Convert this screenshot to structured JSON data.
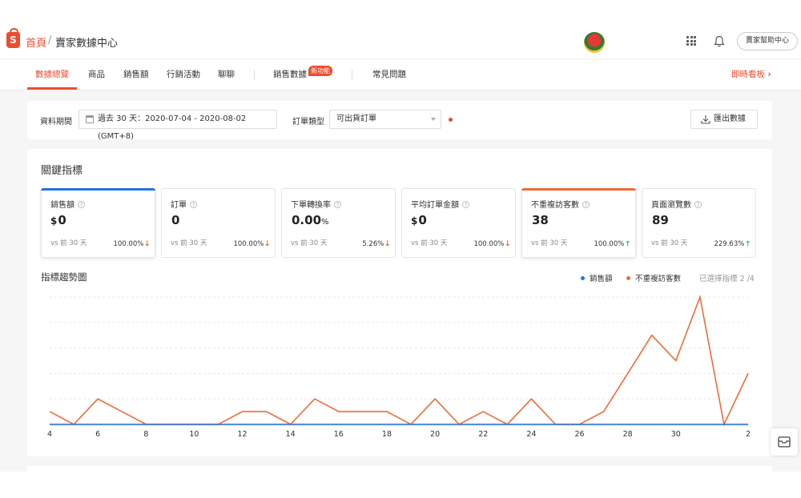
{
  "breadcrumb": {
    "home": "首頁",
    "separator": "/",
    "title": "賣家數據中心"
  },
  "header": {
    "help_label": "賣家幫助中心"
  },
  "nav": {
    "tabs": [
      "數據總覽",
      "商品",
      "銷售額",
      "行銷活動",
      "聊聊",
      "銷售數據",
      "常見問題"
    ],
    "new_badge": "新功能",
    "live_link": "即時看板",
    "active_index": 0
  },
  "filters": {
    "period_label": "資料期間",
    "period_value": "過去 30 天：2020-07-04 - 2020-08-02 (GMT+8)",
    "order_type_label": "訂單類型",
    "order_type_value": "可出貨訂單",
    "export_label": "匯出數據"
  },
  "key_metrics": {
    "title": "關鍵指標",
    "items": [
      {
        "label": "銷售額",
        "currency": "$",
        "value": "0",
        "unit": "",
        "vs": "vs 前 30 天",
        "change": "100.00%",
        "direction": "down",
        "selected": true,
        "color": "#2673dd"
      },
      {
        "label": "訂單",
        "currency": "",
        "value": "0",
        "unit": "",
        "vs": "vs 前 30 天",
        "change": "100.00%",
        "direction": "down",
        "selected": false,
        "color": ""
      },
      {
        "label": "下單轉換率",
        "currency": "",
        "value": "0.00",
        "unit": "%",
        "vs": "vs 前 30 天",
        "change": "5.26%",
        "direction": "down",
        "selected": false,
        "color": ""
      },
      {
        "label": "平均訂單金額",
        "currency": "$",
        "value": "0",
        "unit": "",
        "vs": "vs 前 30 天",
        "change": "100.00%",
        "direction": "down",
        "selected": false,
        "color": ""
      },
      {
        "label": "不重複訪客數",
        "currency": "",
        "value": "38",
        "unit": "",
        "vs": "vs 前 30 天",
        "change": "100.00%",
        "direction": "up",
        "selected": true,
        "color": "#ee6c3a"
      },
      {
        "label": "頁面瀏覽數",
        "currency": "",
        "value": "89",
        "unit": "",
        "vs": "vs 前 30 天",
        "change": "229.63%",
        "direction": "up",
        "selected": false,
        "color": ""
      }
    ]
  },
  "trend": {
    "title": "指標趨勢圖",
    "selected_count": "已選擇指標 2 /4"
  },
  "chart_data": {
    "type": "line",
    "x": [
      4,
      5,
      6,
      7,
      8,
      9,
      10,
      11,
      12,
      13,
      14,
      15,
      16,
      17,
      18,
      19,
      20,
      21,
      22,
      23,
      24,
      25,
      26,
      27,
      28,
      29,
      30,
      31,
      1,
      2
    ],
    "x_tick_labels": [
      "4",
      "6",
      "8",
      "10",
      "12",
      "14",
      "16",
      "18",
      "20",
      "22",
      "24",
      "26",
      "28",
      "30",
      "2"
    ],
    "series": [
      {
        "name": "銷售額",
        "color": "#2673dd",
        "values": [
          0,
          0,
          0,
          0,
          0,
          0,
          0,
          0,
          0,
          0,
          0,
          0,
          0,
          0,
          0,
          0,
          0,
          0,
          0,
          0,
          0,
          0,
          0,
          0,
          0,
          0,
          0,
          0,
          0,
          0
        ]
      },
      {
        "name": "不重複訪客數",
        "color": "#ee6c3a",
        "values": [
          1,
          0,
          2,
          1,
          0,
          0,
          0,
          0,
          1,
          1,
          0,
          2,
          1,
          1,
          1,
          0,
          2,
          0,
          1,
          0,
          2,
          0,
          0,
          1,
          4,
          7,
          5,
          10,
          0,
          4
        ]
      }
    ],
    "ylim": [
      0,
      10
    ],
    "grid": true,
    "legend": "top-right"
  }
}
